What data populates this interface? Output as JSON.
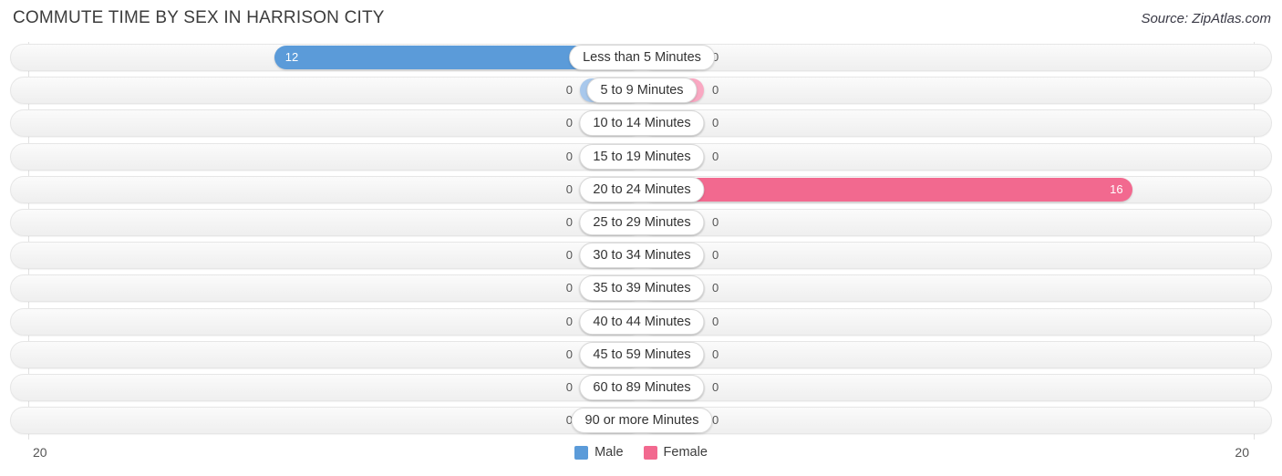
{
  "header": {
    "title": "COMMUTE TIME BY SEX IN HARRISON CITY",
    "source": "Source: ZipAtlas.com"
  },
  "legend": {
    "items": [
      {
        "label": "Male",
        "color": "#5b9bd9"
      },
      {
        "label": "Female",
        "color": "#f2698f"
      }
    ]
  },
  "axis": {
    "left_end": "20",
    "right_end": "20"
  },
  "chart_data": {
    "type": "bar",
    "title": "COMMUTE TIME BY SEX IN HARRISON CITY",
    "subtitle": "Source: ZipAtlas.com",
    "orientation": "horizontal-diverging",
    "xlabel": "",
    "ylabel": "",
    "xlim": [
      -20,
      20
    ],
    "axis_max": 20,
    "grid": true,
    "legend_position": "bottom-center",
    "categories": [
      "Less than 5 Minutes",
      "5 to 9 Minutes",
      "10 to 14 Minutes",
      "15 to 19 Minutes",
      "20 to 24 Minutes",
      "25 to 29 Minutes",
      "30 to 34 Minutes",
      "35 to 39 Minutes",
      "40 to 44 Minutes",
      "45 to 59 Minutes",
      "60 to 89 Minutes",
      "90 or more Minutes"
    ],
    "series": [
      {
        "name": "Male",
        "color": "#5b9bd9",
        "direction": "left",
        "values": [
          12,
          0,
          0,
          0,
          0,
          0,
          0,
          0,
          0,
          0,
          0,
          0
        ],
        "labels": [
          "12",
          "0",
          "0",
          "0",
          "0",
          "0",
          "0",
          "0",
          "0",
          "0",
          "0",
          "0"
        ]
      },
      {
        "name": "Female",
        "color": "#f2698f",
        "direction": "right",
        "values": [
          0,
          0,
          0,
          0,
          16,
          0,
          0,
          0,
          0,
          0,
          0,
          0
        ],
        "labels": [
          "0",
          "0",
          "0",
          "0",
          "16",
          "0",
          "0",
          "0",
          "0",
          "0",
          "0",
          "0"
        ]
      }
    ]
  }
}
